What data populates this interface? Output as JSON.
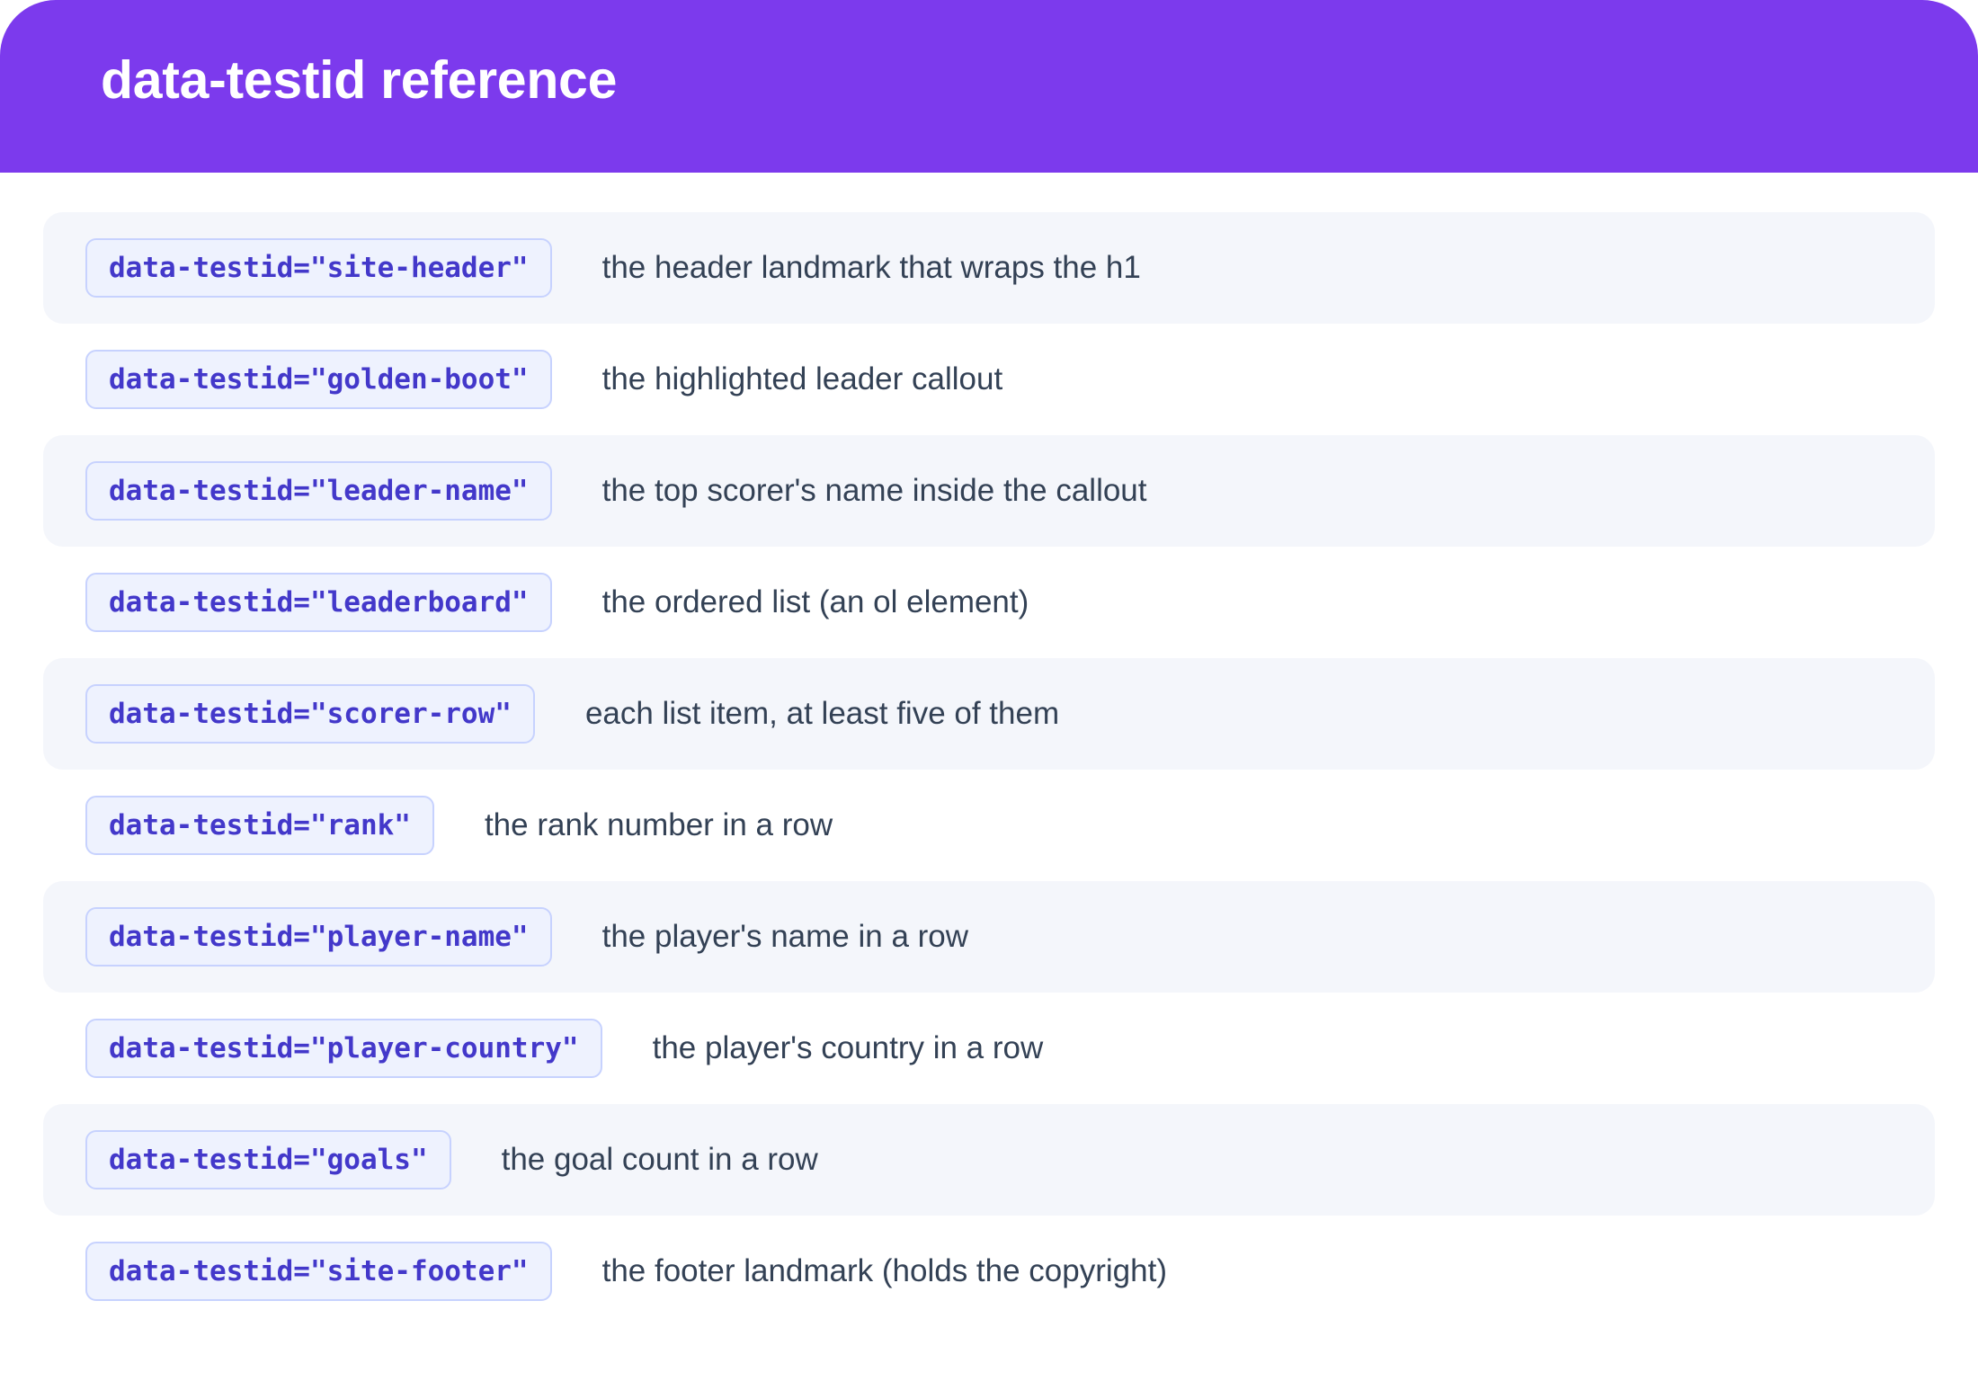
{
  "header": {
    "title": "data-testid reference"
  },
  "rows": [
    {
      "code": "data-testid=\"site-header\"",
      "description": "the header landmark that wraps the h1"
    },
    {
      "code": "data-testid=\"golden-boot\"",
      "description": "the highlighted leader callout"
    },
    {
      "code": "data-testid=\"leader-name\"",
      "description": "the top scorer's name inside the callout"
    },
    {
      "code": "data-testid=\"leaderboard\"",
      "description": "the ordered list (an ol element)"
    },
    {
      "code": "data-testid=\"scorer-row\"",
      "description": "each list item, at least five of them"
    },
    {
      "code": "data-testid=\"rank\"",
      "description": "the rank number in a row"
    },
    {
      "code": "data-testid=\"player-name\"",
      "description": "the player's name in a row"
    },
    {
      "code": "data-testid=\"player-country\"",
      "description": "the player's country in a row"
    },
    {
      "code": "data-testid=\"goals\"",
      "description": "the goal count in a row"
    },
    {
      "code": "data-testid=\"site-footer\"",
      "description": "the footer landmark (holds the copyright)"
    }
  ],
  "colors": {
    "header_bg": "#7c3aed",
    "row_shade": "#f4f6fb",
    "chip_bg": "#eef2fe",
    "chip_border": "#c7d2fe",
    "chip_text": "#4338ca",
    "desc_text": "#334155"
  }
}
